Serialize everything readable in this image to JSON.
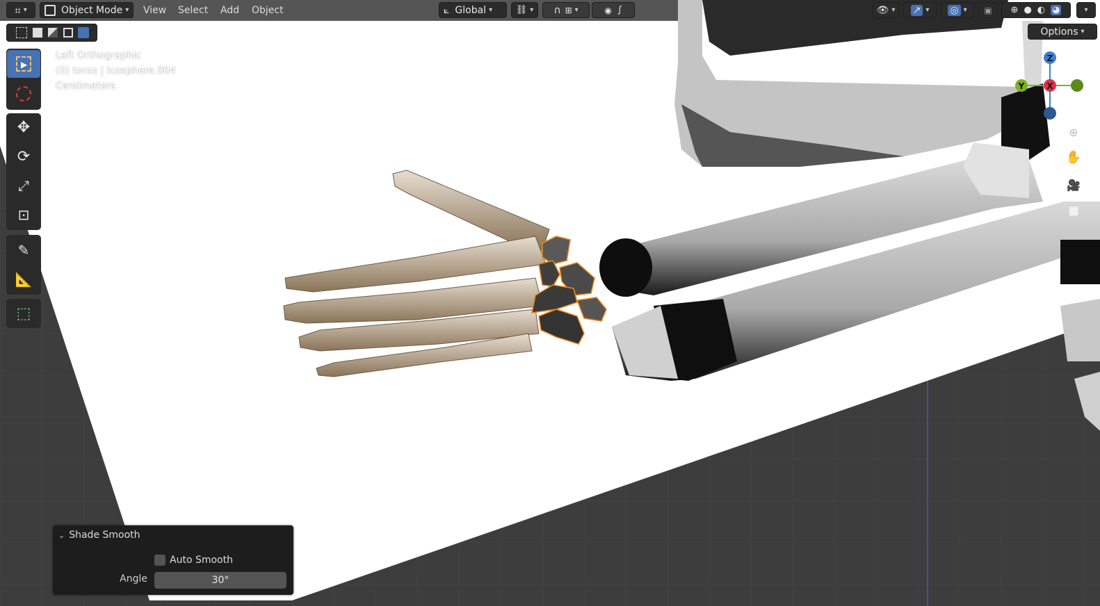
{
  "header": {
    "mode_label": "Object Mode",
    "menu": [
      "View",
      "Select",
      "Add",
      "Object"
    ],
    "transform_orientation": "Global",
    "options_label": "Options"
  },
  "viewport_info": {
    "view_name": "Left Orthographic",
    "object_info": "(0) torso | Icosphere.004",
    "units": "Centimeters"
  },
  "gizmo": {
    "z": "Z",
    "y": "Y",
    "x": "X"
  },
  "operator_panel": {
    "title": "Shade Smooth",
    "auto_smooth_label": "Auto Smooth",
    "auto_smooth_checked": false,
    "angle_label": "Angle",
    "angle_value": "30°"
  },
  "toolbar": {
    "tools": [
      "select-box",
      "cursor",
      "move",
      "rotate",
      "scale",
      "transform",
      "annotate",
      "measure",
      "add-cube"
    ],
    "active": "select-box"
  },
  "colors": {
    "accent": "#4772b3",
    "selection_outline": "#e8861a",
    "header_bg": "#303030",
    "grid_bg": "#3d3d3d"
  }
}
